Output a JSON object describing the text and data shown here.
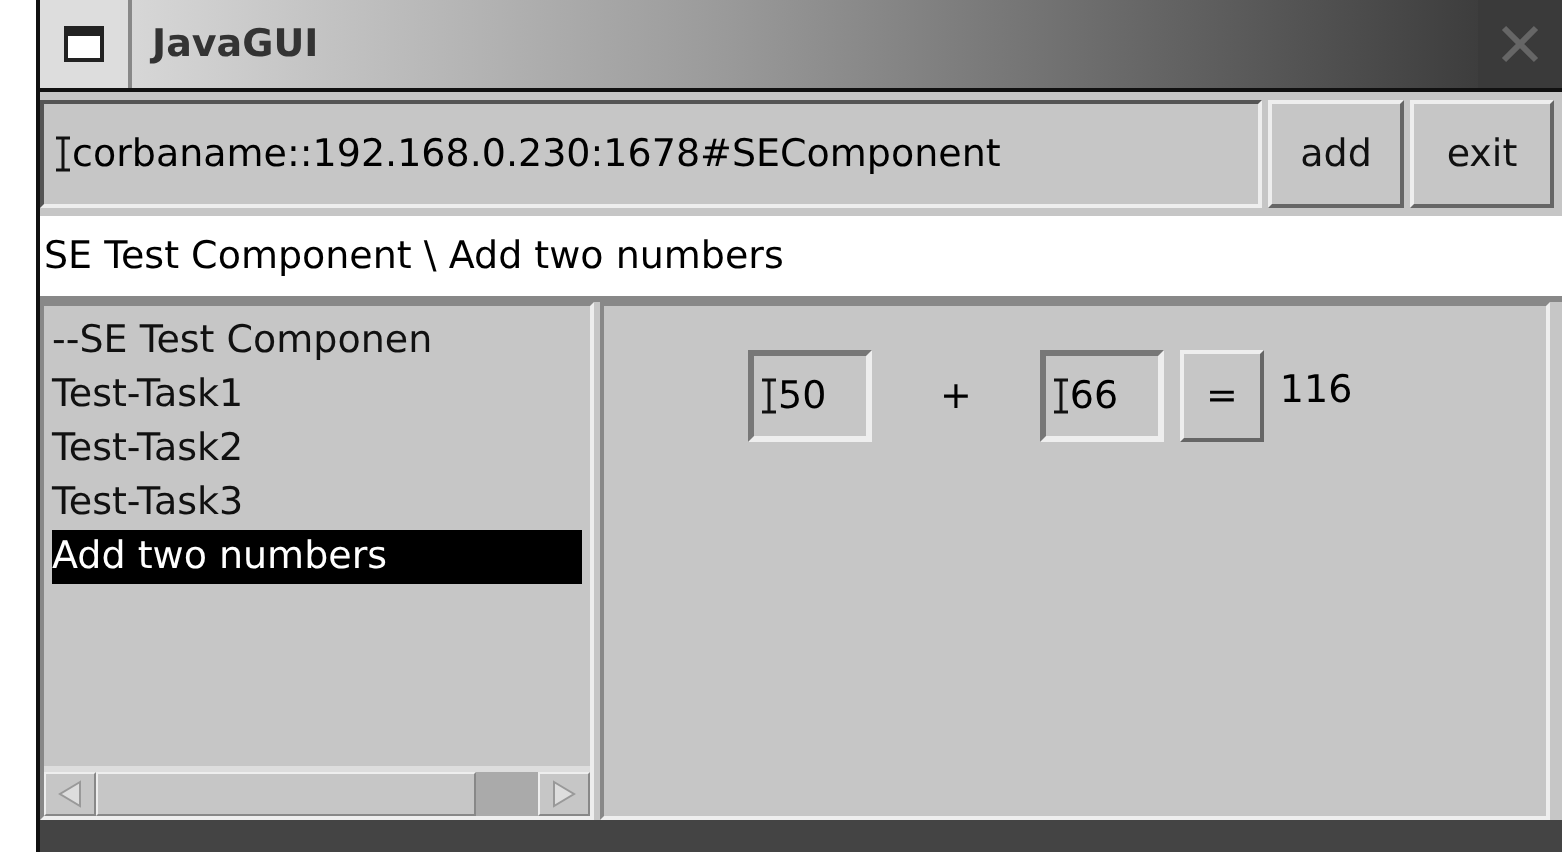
{
  "window": {
    "title": "JavaGUI"
  },
  "toolbar": {
    "address": "corbaname::192.168.0.230:1678#SEComponent",
    "buttons": [
      "add",
      "exit"
    ]
  },
  "breadcrumb": "SE Test Component \\ Add two numbers",
  "tree": [
    {
      "label": "--SE Test Componen",
      "selected": false
    },
    {
      "label": "Test-Task1",
      "selected": false
    },
    {
      "label": "Test-Task2",
      "selected": false
    },
    {
      "label": "Test-Task3",
      "selected": false
    },
    {
      "label": "Add two numbers",
      "selected": true
    }
  ],
  "calculator": {
    "first": "50",
    "operator": "+",
    "second": "66",
    "equals": "=",
    "result": "116"
  }
}
